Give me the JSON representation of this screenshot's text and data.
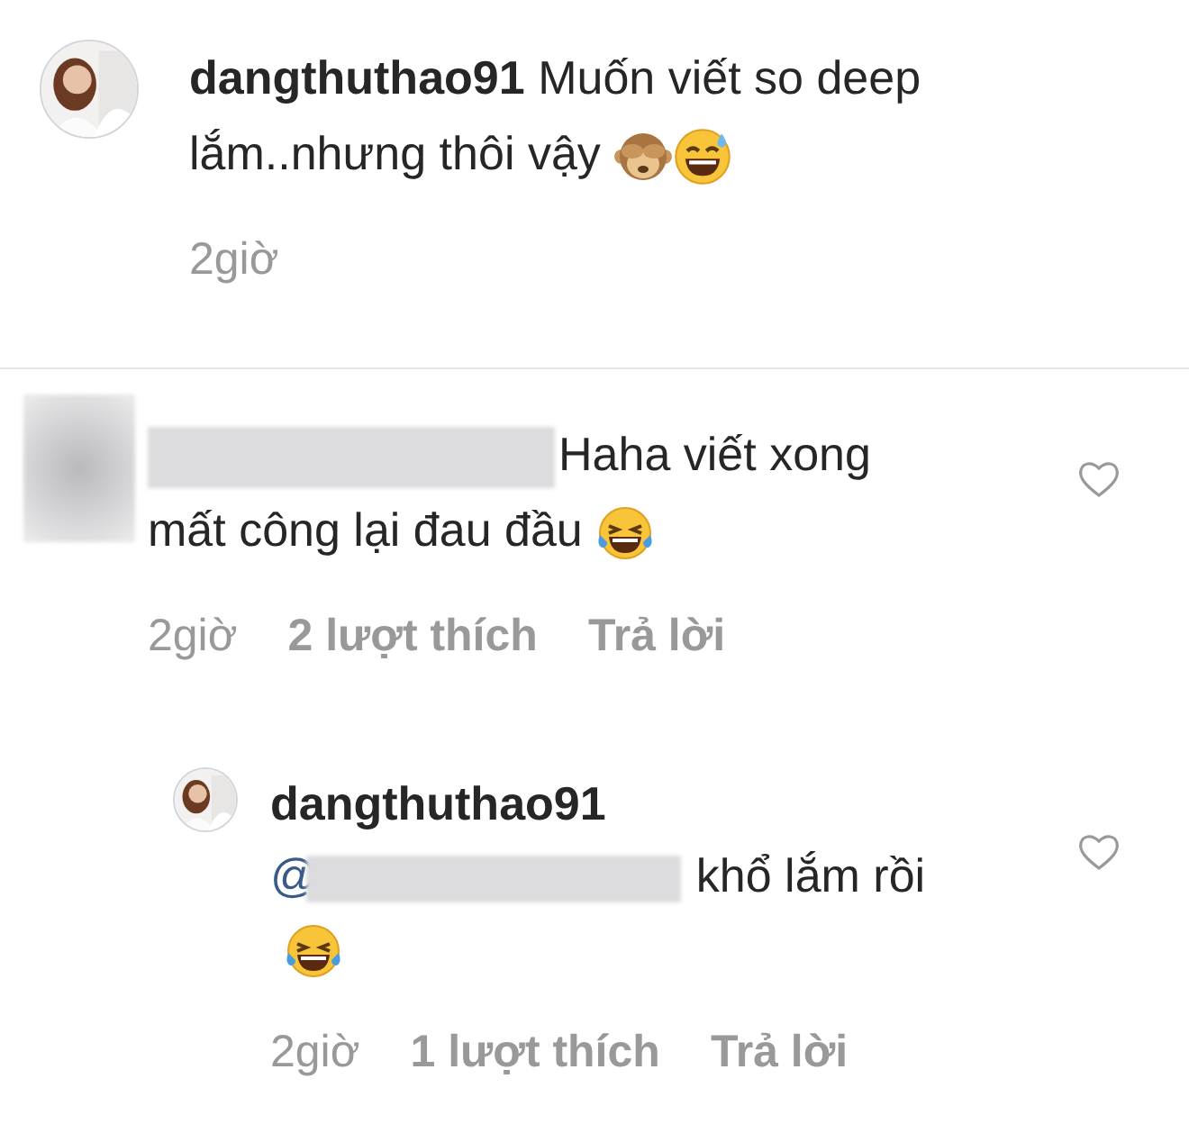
{
  "comments": [
    {
      "kind": "caption",
      "username": "dangthuthao91",
      "text": "Muốn viết so deep lắm..nhưng thôi vậy",
      "emojis": [
        {
          "kind": "monkey"
        },
        {
          "kind": "sweat"
        }
      ],
      "time": "2giờ"
    },
    {
      "kind": "comment",
      "text": "Haha viết xong mất công lại đau đầu",
      "emojis": [
        {
          "kind": "joy"
        }
      ],
      "time": "2giờ",
      "likes": "2 lượt thích",
      "reply": "Trả lời"
    },
    {
      "kind": "reply",
      "username": "dangthuthao91",
      "mention": "@",
      "text": "khổ lắm rồi",
      "emojis": [
        {
          "kind": "joy"
        }
      ],
      "time": "2giờ",
      "likes": "1 lượt thích",
      "reply": "Trả lời"
    }
  ]
}
